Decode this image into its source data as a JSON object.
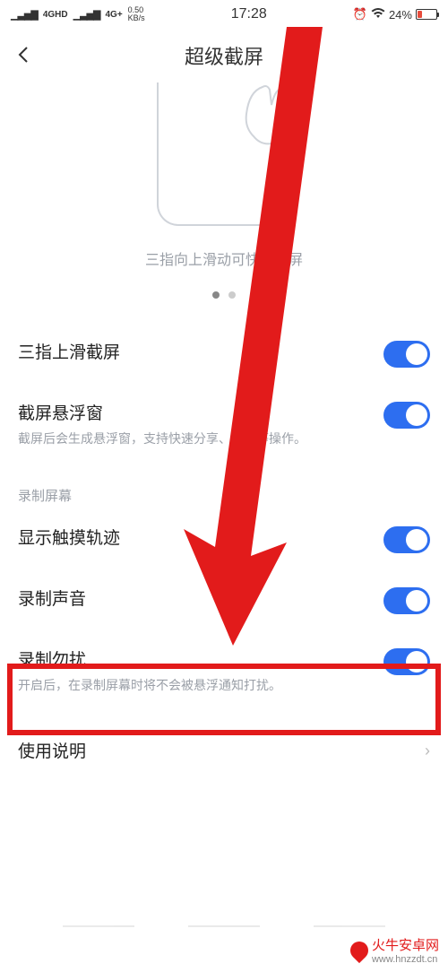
{
  "statusBar": {
    "network1": "4GHD",
    "network2": "4G+",
    "speed": "0.50",
    "speedUnit": "KB/s",
    "time": "17:28",
    "battery": "24%"
  },
  "header": {
    "title": "超级截屏"
  },
  "tutorial": {
    "caption": "三指向上滑动可快速截屏"
  },
  "settings": {
    "item1": {
      "label": "三指上滑截屏"
    },
    "item2": {
      "label": "截屏悬浮窗",
      "desc": "截屏后会生成悬浮窗，支持快速分享、编辑等操作。"
    },
    "sectionTitle": "录制屏幕",
    "item3": {
      "label": "显示触摸轨迹"
    },
    "item4": {
      "label": "录制声音"
    },
    "item5": {
      "label": "录制勿扰",
      "desc": "开启后，在录制屏幕时将不会被悬浮通知打扰。"
    },
    "item6": {
      "label": "使用说明"
    }
  },
  "watermark": {
    "name": "火牛安卓网",
    "url": "www.hnzzdt.cn"
  }
}
